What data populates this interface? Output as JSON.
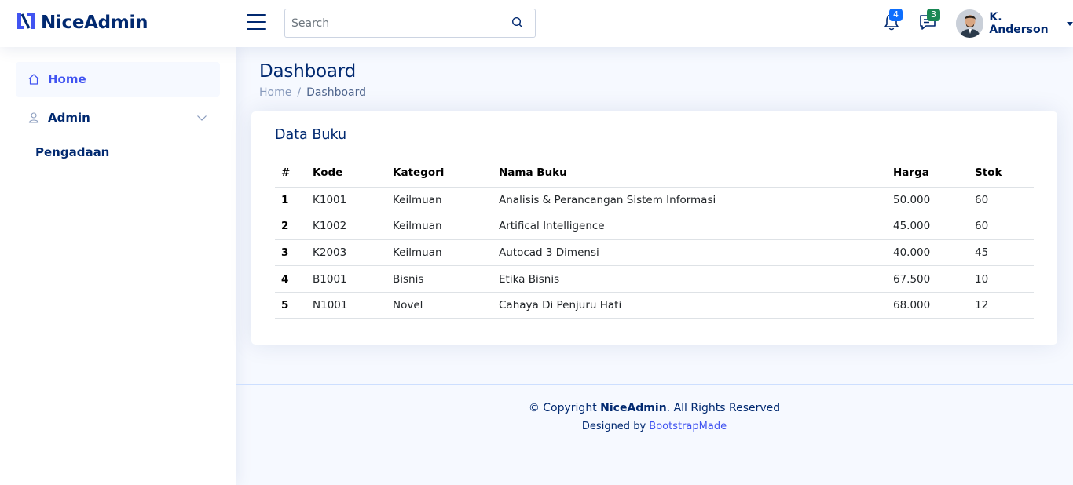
{
  "header": {
    "logo_text": "NiceAdmin",
    "search_placeholder": "Search",
    "notifications_count": "4",
    "messages_count": "3",
    "profile_name": "K. Anderson"
  },
  "sidebar": {
    "items": [
      {
        "label": "Home",
        "icon": "house-icon",
        "active": true
      },
      {
        "label": "Admin",
        "icon": "person-icon",
        "active": false
      }
    ],
    "sub_label": "Pengadaan"
  },
  "page": {
    "title": "Dashboard",
    "breadcrumb": [
      "Home",
      "Dashboard"
    ]
  },
  "card": {
    "title": "Data Buku",
    "columns": [
      "#",
      "Kode",
      "Kategori",
      "Nama Buku",
      "Harga",
      "Stok"
    ],
    "rows": [
      [
        "1",
        "K1001",
        "Keilmuan",
        "Analisis & Perancangan Sistem Informasi",
        "50.000",
        "60"
      ],
      [
        "2",
        "K1002",
        "Keilmuan",
        "Artifical Intelligence",
        "45.000",
        "60"
      ],
      [
        "3",
        "K2003",
        "Keilmuan",
        "Autocad 3 Dimensi",
        "40.000",
        "45"
      ],
      [
        "4",
        "B1001",
        "Bisnis",
        "Etika Bisnis",
        "67.500",
        "10"
      ],
      [
        "5",
        "N1001",
        "Novel",
        "Cahaya Di Penjuru Hati",
        "68.000",
        "12"
      ]
    ]
  },
  "footer": {
    "copy_prefix": "© Copyright ",
    "copy_brand": "NiceAdmin",
    "copy_suffix": ". All Rights Reserved",
    "designed_by": "Designed by ",
    "designer_link": "BootstrapMade"
  },
  "colors": {
    "brand": "#012970",
    "accent": "#4154f1",
    "badge_notifications": "#0d6efd",
    "badge_messages": "#198754",
    "page_background": "#f6f9ff"
  }
}
